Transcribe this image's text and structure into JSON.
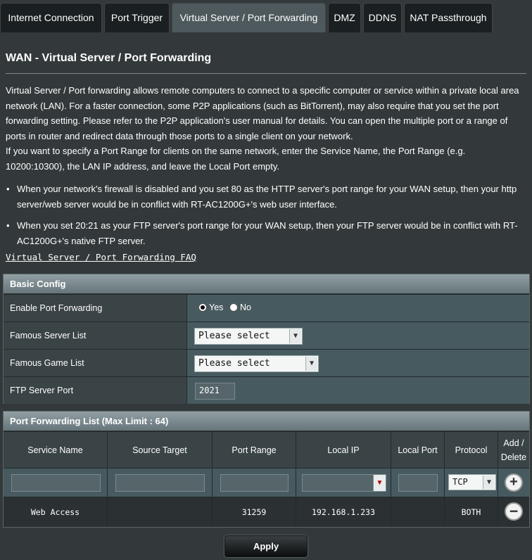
{
  "tabs": [
    {
      "label": "Internet Connection",
      "active": false
    },
    {
      "label": "Port Trigger",
      "active": false
    },
    {
      "label": "Virtual Server / Port Forwarding",
      "active": true
    },
    {
      "label": "DMZ",
      "active": false
    },
    {
      "label": "DDNS",
      "active": false
    },
    {
      "label": "NAT Passthrough",
      "active": false
    }
  ],
  "page": {
    "title": "WAN - Virtual Server / Port Forwarding",
    "description_1": "Virtual Server / Port forwarding allows remote computers to connect to a specific computer or service within a private local area network (LAN). For a faster connection, some P2P applications (such as BitTorrent), may also require that you set the port forwarding setting. Please refer to the P2P application's user manual for details. You can open the multiple port or a range of ports in router and redirect data through those ports to a single client on your network.",
    "description_2": "If you want to specify a Port Range for clients on the same network, enter the Service Name, the Port Range (e.g. 10200:10300), the LAN IP address, and leave the Local Port empty.",
    "bullet_1": "When your network's firewall is disabled and you set 80 as the HTTP server's port range for your WAN setup, then your http server/web server would be in conflict with RT-AC1200G+'s web user interface.",
    "bullet_2": "When you set 20:21 as your FTP server's port range for your WAN setup, then your FTP server would be in conflict with RT-AC1200G+'s native FTP server.",
    "faq_link": "Virtual Server / Port Forwarding FAQ"
  },
  "basic_config": {
    "header": "Basic Config",
    "enable_label": "Enable Port Forwarding",
    "yes_label": "Yes",
    "no_label": "No",
    "enable_value": "Yes",
    "famous_server_label": "Famous Server List",
    "famous_server_value": "Please select",
    "famous_game_label": "Famous Game List",
    "famous_game_value": "Please select",
    "ftp_port_label": "FTP Server Port",
    "ftp_port_value": "2021"
  },
  "pf_list": {
    "header": "Port Forwarding List (Max Limit : 64)",
    "columns": [
      "Service Name",
      "Source Target",
      "Port Range",
      "Local IP",
      "Local Port",
      "Protocol",
      "Add / Delete"
    ],
    "new_protocol": "TCP",
    "rows": [
      {
        "service_name": "Web Access",
        "source_target": "",
        "port_range": "31259",
        "local_ip": "192.168.1.233",
        "local_port": "",
        "protocol": "BOTH"
      }
    ]
  },
  "apply_label": "Apply",
  "icons": {
    "add": "plus-circle-icon",
    "delete": "minus-circle-icon",
    "dropdown": "chevron-down-icon"
  }
}
